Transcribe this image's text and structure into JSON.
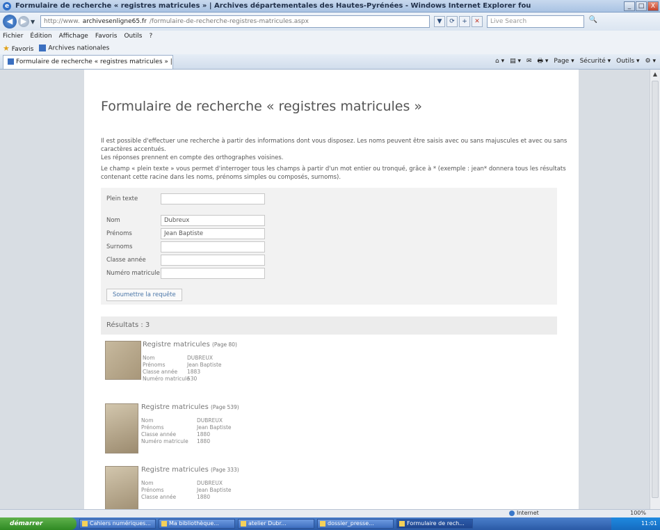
{
  "window": {
    "title": "Formulaire de recherche « registres matricules » | Archives départementales des Hautes-Pyrénées - Windows Internet Explorer fou",
    "btn_min": "_",
    "btn_max": "□",
    "btn_close": "X"
  },
  "nav": {
    "back_glyph": "◀",
    "forward_glyph": "▶",
    "dropdown_glyph": "▼"
  },
  "address": {
    "prefix": "http://www.",
    "host": "archivesenligne65.fr",
    "path": "/formulaire-de-recherche-registres-matricules.aspx"
  },
  "address_tools": {
    "dropdown": "▼",
    "refresh": "⟳",
    "favorite": "+",
    "stop": "✕"
  },
  "search": {
    "placeholder": "Live Search",
    "go": "🔍"
  },
  "menu": {
    "items": [
      "Fichier",
      "Édition",
      "Affichage",
      "Favoris",
      "Outils",
      "?"
    ]
  },
  "favorites": {
    "label": "Favoris",
    "item": "Archives nationales"
  },
  "tab": {
    "label": "Formulaire de recherche « registres matricules » | Arc..."
  },
  "commandbar": {
    "items": [
      "⌂ ▾",
      "▤ ▾",
      "✉",
      "🖶 ▾",
      "Page ▾",
      "Sécurité ▾",
      "Outils ▾",
      "⚙ ▾"
    ]
  },
  "page": {
    "title": "Formulaire de recherche « registres matricules »",
    "intro_1": "Il est possible d'effectuer une recherche à partir des informations dont vous disposez. Les noms peuvent être saisis avec ou sans majuscules et avec ou sans caractères accentués.",
    "intro_2": "Les réponses prennent en compte des orthographes voisines.",
    "intro_3": "Le champ « plein texte » vous permet d'interroger tous les champs à partir d'un mot entier ou tronqué, grâce à * (exemple : jean* donnera tous les résultats contenant cette racine dans les noms, prénoms simples ou composés, surnoms)."
  },
  "form": {
    "fulltext_label": "Plein texte",
    "fulltext_value": "",
    "nom_label": "Nom",
    "nom_value": "Dubreux",
    "prenoms_label": "Prénoms",
    "prenoms_value": "Jean Baptiste",
    "surnoms_label": "Surnoms",
    "surnoms_value": "",
    "classe_label": "Classe année",
    "classe_value": "",
    "matricule_label": "Numéro matricule",
    "matricule_value": "",
    "submit_label": "Soumettre la requête"
  },
  "results": {
    "header": "Résultats : 3",
    "items": [
      {
        "title": "Registre matricules",
        "page": "(Page 80)",
        "nom_label": "Nom",
        "nom": "DUBREUX",
        "prenoms_label": "Prénoms",
        "prenoms": "Jean Baptiste",
        "classe_label": "Classe année",
        "classe": "1883",
        "matricule_label": "Numéro matricule",
        "matricule": "530"
      },
      {
        "title": "Registre matricules",
        "page": "(Page 539)",
        "nom_label": "Nom",
        "nom": "DUBREUX",
        "prenoms_label": "Prénoms",
        "prenoms": "Jean Baptiste",
        "classe_label": "Classe année",
        "classe": "1880",
        "matricule_label": "Numéro matricule",
        "matricule": "1880"
      },
      {
        "title": "Registre matricules",
        "page": "(Page 333)",
        "nom_label": "Nom",
        "nom": "DUBREUX",
        "prenoms_label": "Prénoms",
        "prenoms": "Jean Baptiste",
        "classe_label": "Classe année",
        "classe": "1880"
      }
    ]
  },
  "statusbar": {
    "zone": "Internet",
    "zoom": "100%"
  },
  "taskbar": {
    "start": "démarrer",
    "tasks": [
      "Cahiers numériques...",
      "Ma bibliothèque...",
      "atelier Dubr...",
      "dossier_presse...",
      "Formulaire de rech..."
    ],
    "clock": "11:01"
  }
}
